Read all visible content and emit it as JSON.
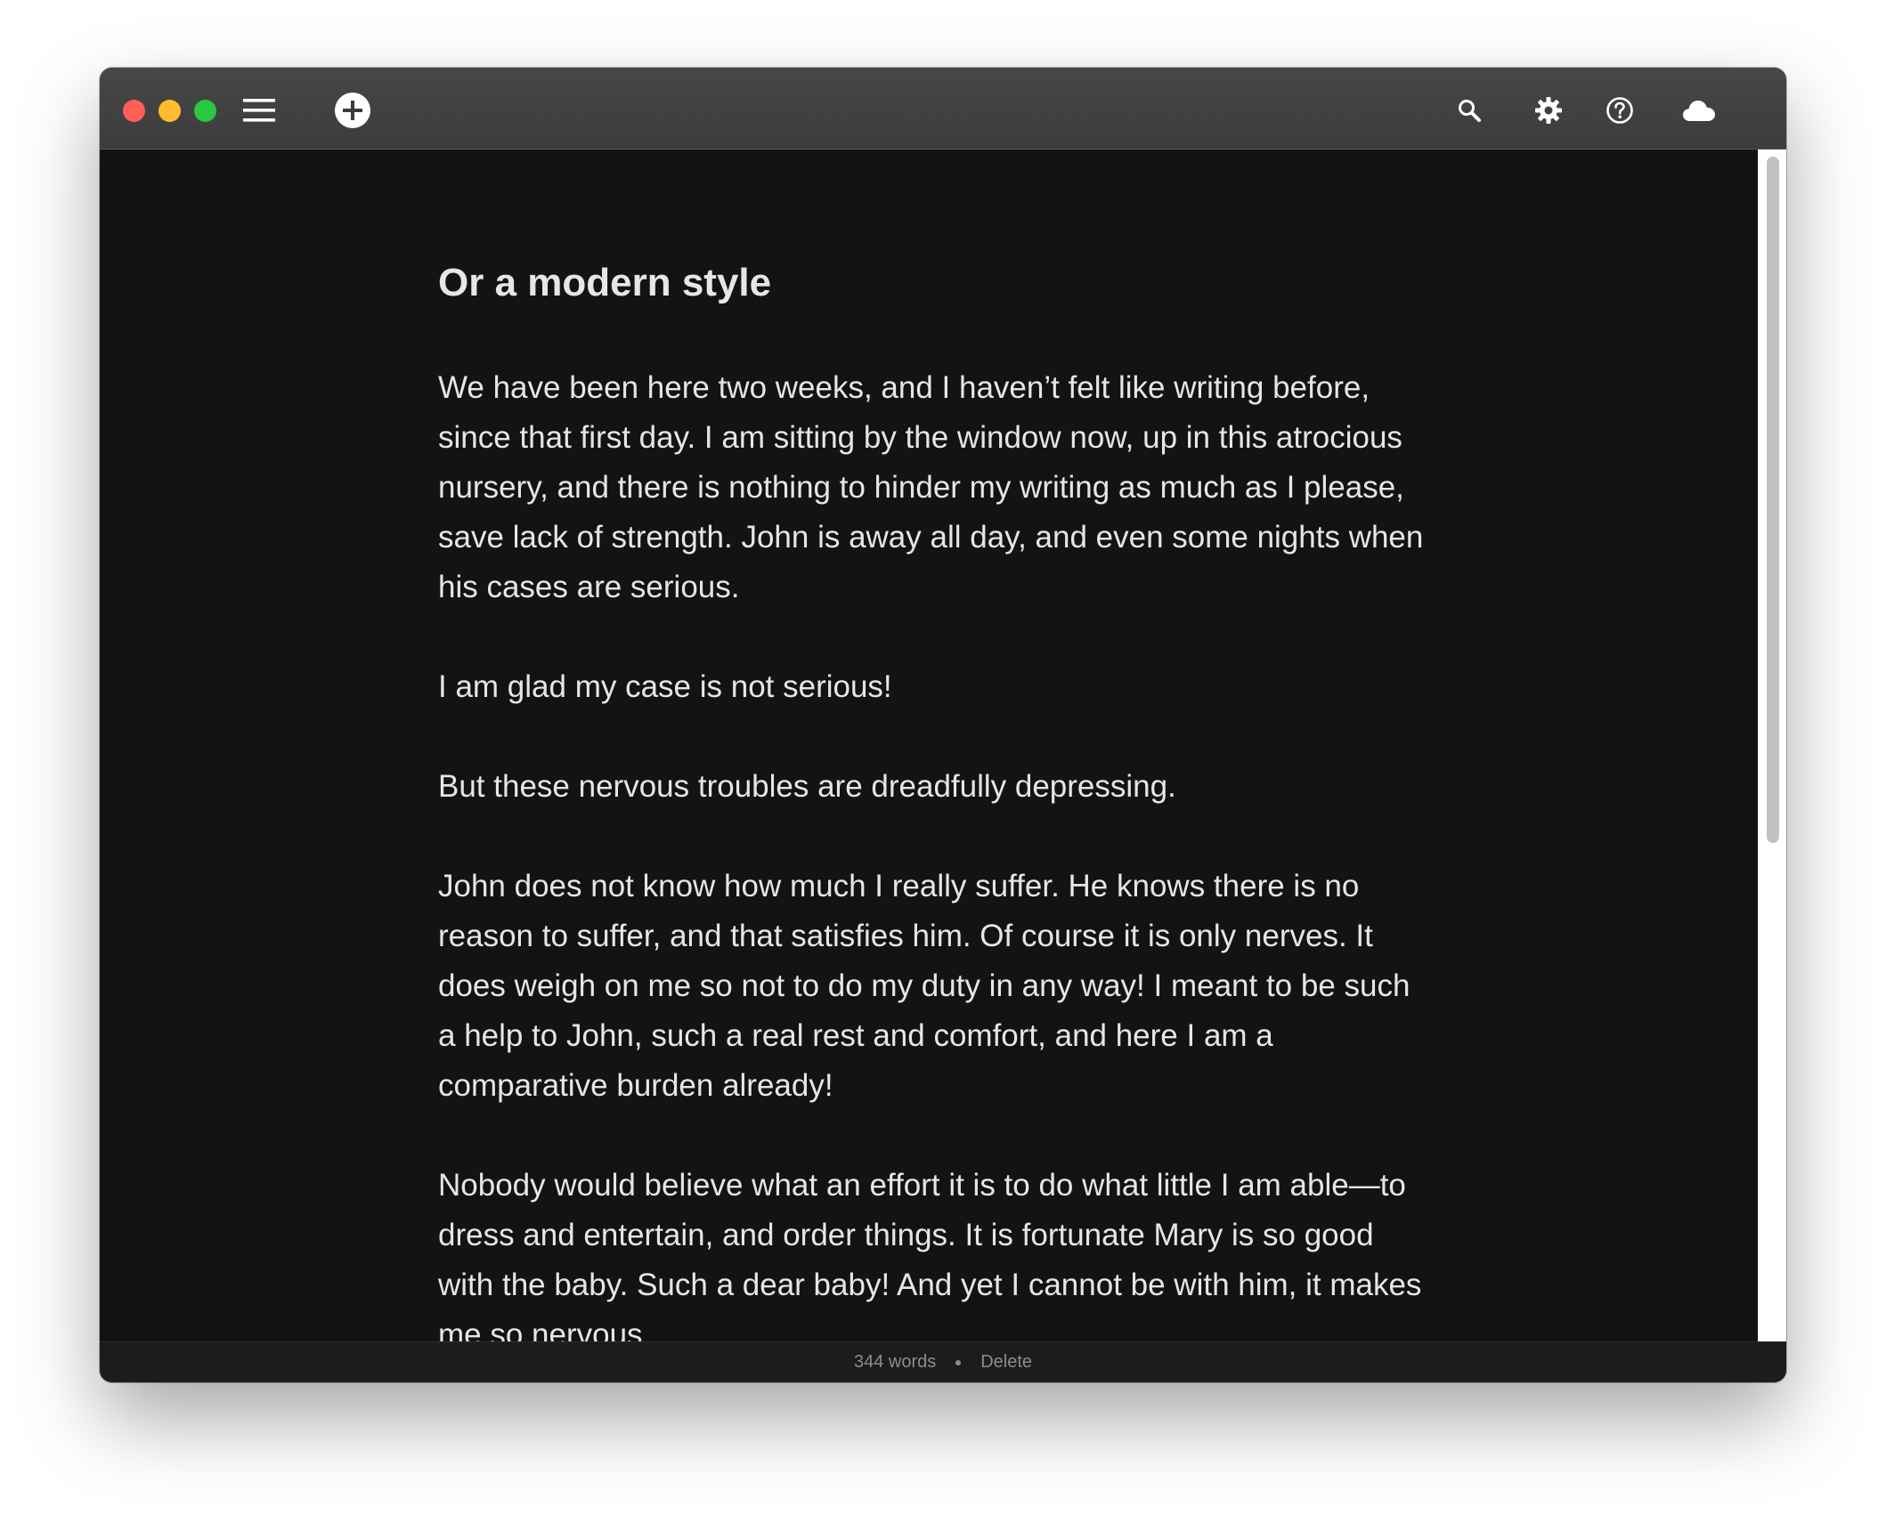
{
  "toolbar": {
    "icons": [
      "menu-icon",
      "plus-circle-icon",
      "search-icon",
      "gear-icon",
      "help-icon",
      "cloud-icon"
    ]
  },
  "document": {
    "title": "Or a modern style",
    "paragraphs": [
      "We have been here two weeks, and I haven’t felt like writing before, since that first day. I am sitting by the window now, up in this atrocious nursery, and there is nothing to hinder my writing as much as I please, save lack of strength. John is away all day, and even some nights when his cases are serious.",
      "I am glad my case is not serious!",
      "But these nervous troubles are dreadfully depressing.",
      "John does not know how much I really suffer. He knows there is no reason to suffer, and that satisfies him. Of course it is only nerves. It does weigh on me so not to do my duty in any way! I meant to be such a help to John, such a real rest and comfort, and here I am a comparative burden already!",
      "Nobody would believe what an effort it is to do what little I am able—to dress and entertain, and order things. It is fortunate Mary is so good with the baby. Such a dear baby! And yet I cannot be with him, it makes me so nervous."
    ]
  },
  "status": {
    "word_count": "344 words",
    "delete_label": "Delete"
  },
  "colors": {
    "background": "#131313",
    "text": "#e6e6e6",
    "titlebar": "#424242",
    "close": "#ff5f57",
    "minimize": "#febc2e",
    "zoom": "#28c840"
  }
}
